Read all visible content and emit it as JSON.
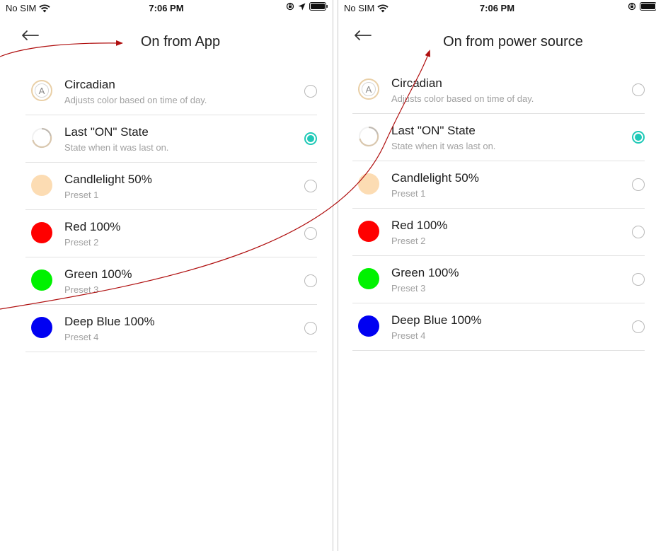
{
  "screens": [
    {
      "status": {
        "carrier": "No SIM",
        "time": "7:06 PM"
      },
      "title": "On from App",
      "options": [
        {
          "title": "Circadian",
          "subtitle": "Adjusts color based on time of day.",
          "icon": "circadian-icon",
          "icon_letter": "A",
          "selected": false
        },
        {
          "title": "Last \"ON\" State",
          "subtitle": "State when it was last on.",
          "icon": "last-state-icon",
          "selected": true
        },
        {
          "title": "Candlelight 50%",
          "subtitle": "Preset 1",
          "icon": "candlelight-swatch",
          "color": "#fcdcb3",
          "selected": false
        },
        {
          "title": "Red 100%",
          "subtitle": "Preset 2",
          "icon": "red-swatch",
          "color": "#ff0000",
          "selected": false
        },
        {
          "title": "Green 100%",
          "subtitle": "Preset 3",
          "icon": "green-swatch",
          "color": "#00f200",
          "selected": false
        },
        {
          "title": "Deep Blue 100%",
          "subtitle": "Preset 4",
          "icon": "blue-swatch",
          "color": "#0000f2",
          "selected": false
        }
      ]
    },
    {
      "status": {
        "carrier": "No SIM",
        "time": "7:06 PM"
      },
      "title": "On from power source",
      "options": [
        {
          "title": "Circadian",
          "subtitle": "Adjusts color based on time of day.",
          "icon": "circadian-icon",
          "icon_letter": "A",
          "selected": false
        },
        {
          "title": "Last \"ON\" State",
          "subtitle": "State when it was last on.",
          "icon": "last-state-icon",
          "selected": true
        },
        {
          "title": "Candlelight 50%",
          "subtitle": "Preset 1",
          "icon": "candlelight-swatch",
          "color": "#fcdcb3",
          "selected": false
        },
        {
          "title": "Red 100%",
          "subtitle": "Preset 2",
          "icon": "red-swatch",
          "color": "#ff0000",
          "selected": false
        },
        {
          "title": "Green 100%",
          "subtitle": "Preset 3",
          "icon": "green-swatch",
          "color": "#00f200",
          "selected": false
        },
        {
          "title": "Deep Blue 100%",
          "subtitle": "Preset 4",
          "icon": "blue-swatch",
          "color": "#0000f2",
          "selected": false
        }
      ]
    }
  ],
  "colors": {
    "accent": "#1fc9b7",
    "annotation": "#b01010",
    "divider": "#e2e2e2"
  }
}
